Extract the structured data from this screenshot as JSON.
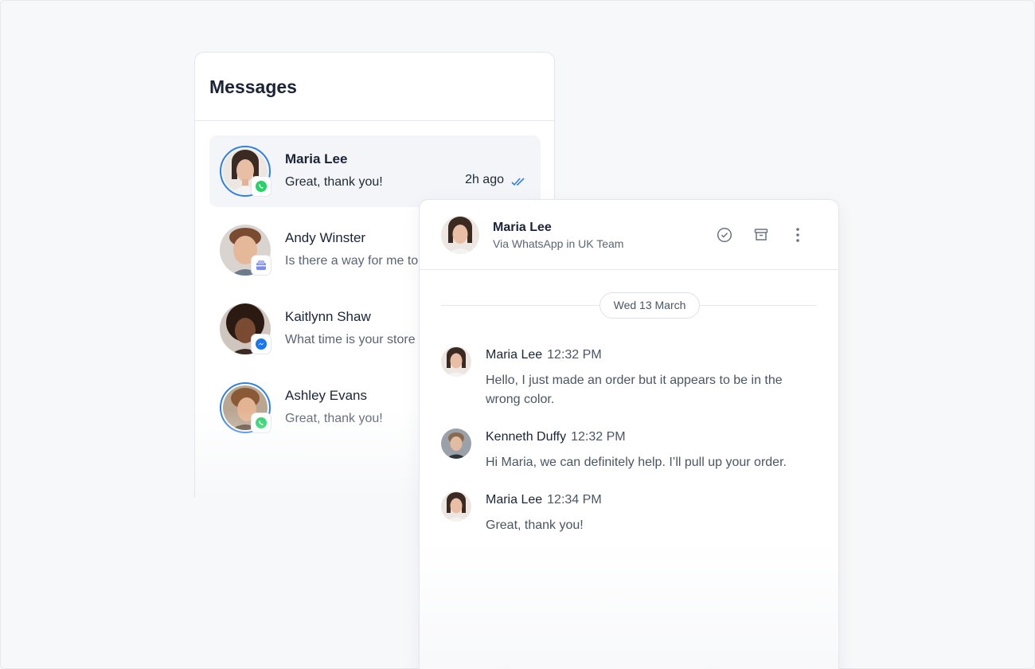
{
  "inbox": {
    "title": "Messages",
    "conversations": [
      {
        "name": "Maria Lee",
        "preview": "Great, thank you!",
        "time": "2h ago",
        "channel": "whatsapp-icon",
        "selected": true
      },
      {
        "name": "Andy Winster",
        "preview": "Is there a way for me to",
        "channel": "inbox-icon"
      },
      {
        "name": "Kaitlynn Shaw",
        "preview": "What time is your store",
        "channel": "messenger-icon"
      },
      {
        "name": "Ashley Evans",
        "preview": "Great, thank you!",
        "channel": "whatsapp-icon"
      }
    ]
  },
  "chat": {
    "contact_name": "Maria Lee",
    "contact_sub": "Via WhatsApp in UK Team",
    "actions": [
      "check-circle-icon",
      "archive-icon",
      "more-vertical-icon"
    ],
    "date_divider": "Wed 13 March",
    "messages": [
      {
        "author": "Maria Lee",
        "time": "12:32 PM",
        "text": "Hello, I just made an order but it appears to be in the wrong color."
      },
      {
        "author": "Kenneth Duffy",
        "time": "12:32 PM",
        "text": "Hi Maria, we can definitely help. I’ll pull up your order."
      },
      {
        "author": "Maria Lee",
        "time": "12:34 PM",
        "text": "Great, thank you!"
      }
    ]
  },
  "colors": {
    "accent": "#2f80ed",
    "whatsapp": "#25d366",
    "messenger": "#1877f2",
    "inbox_icon": "#7b8cf0"
  }
}
